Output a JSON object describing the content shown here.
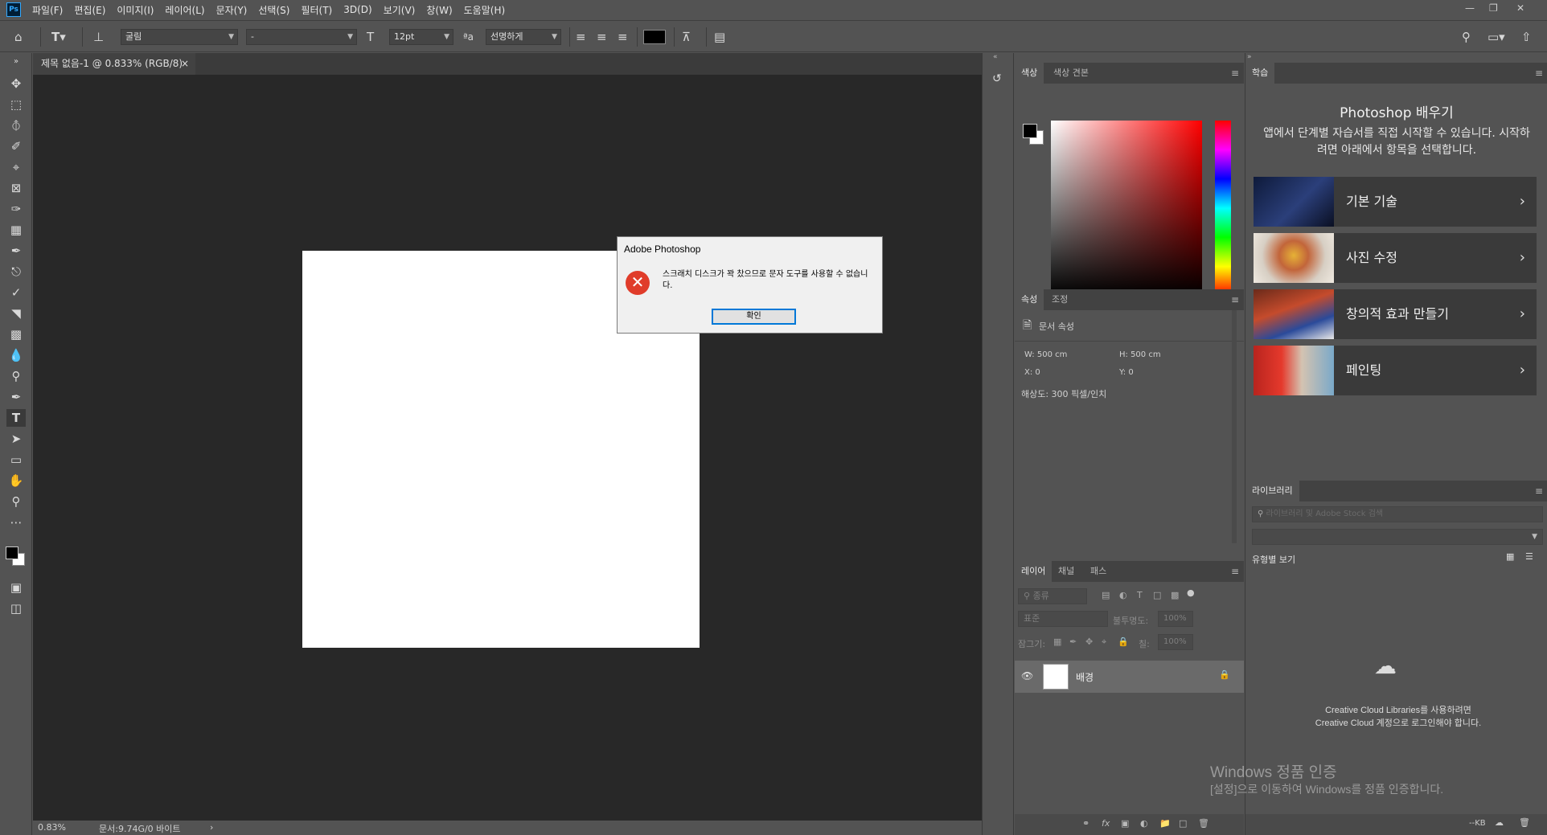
{
  "menubar": {
    "items": [
      "파일(F)",
      "편집(E)",
      "이미지(I)",
      "레이어(L)",
      "문자(Y)",
      "선택(S)",
      "필터(T)",
      "3D(D)",
      "보기(V)",
      "창(W)",
      "도움말(H)"
    ],
    "logo": "Ps"
  },
  "options": {
    "font_family": "굴림",
    "font_style": "-",
    "font_size": "12pt",
    "antialias": "선명하게",
    "color_swatch": "#000000"
  },
  "document": {
    "tab_title": "제목 없음-1 @ 0.833% (RGB/8)",
    "zoom": "0.83%",
    "doc_size": "문서:9.74G/0 바이트"
  },
  "dialog": {
    "title": "Adobe Photoshop",
    "message": "스크래치 디스크가 꽉 찼으므로 문자 도구를 사용할 수 없습니다.",
    "ok_label": "확인"
  },
  "color_panel": {
    "tabs": [
      "색상",
      "색상 견본"
    ],
    "foreground": "#000000",
    "background": "#ffffff"
  },
  "properties_panel": {
    "tabs": [
      "속성",
      "조정"
    ],
    "doc_label": "문서 속성",
    "w": "W:  500 cm",
    "h": "H:  500 cm",
    "x": "X:  0",
    "y": "Y:  0",
    "resolution": "해상도: 300 픽셀/인치"
  },
  "layers_panel": {
    "tabs": [
      "레이어",
      "채널",
      "패스"
    ],
    "filter_placeholder": "종류",
    "blend_mode": "표준",
    "opacity_label": "불투명도:",
    "opacity_value": "100%",
    "lock_label": "잠그기:",
    "fill_label": "칠:",
    "fill_value": "100%",
    "layer_name": "배경"
  },
  "learn_panel": {
    "tab": "학습",
    "title": "Photoshop 배우기",
    "description": "앱에서 단계별 자습서를 직접 시작할 수 있습니다. 시작하려면 아래에서 항목을 선택합니다.",
    "cards": [
      "기본 기술",
      "사진 수정",
      "창의적 효과 만들기",
      "페인팅"
    ]
  },
  "libraries_panel": {
    "tab": "라이브러리",
    "search_placeholder": "라이브러리 및 Adobe Stock 검색",
    "view_label": "유형별 보기",
    "message": "Creative Cloud Libraries를 사용하려면 Creative Cloud 계정으로 로그인해야 합니다.",
    "size": "--KB"
  },
  "watermark": {
    "title": "Windows 정품 인증",
    "subtitle": "[설정]으로 이동하여 Windows를 정품 인증합니다."
  }
}
